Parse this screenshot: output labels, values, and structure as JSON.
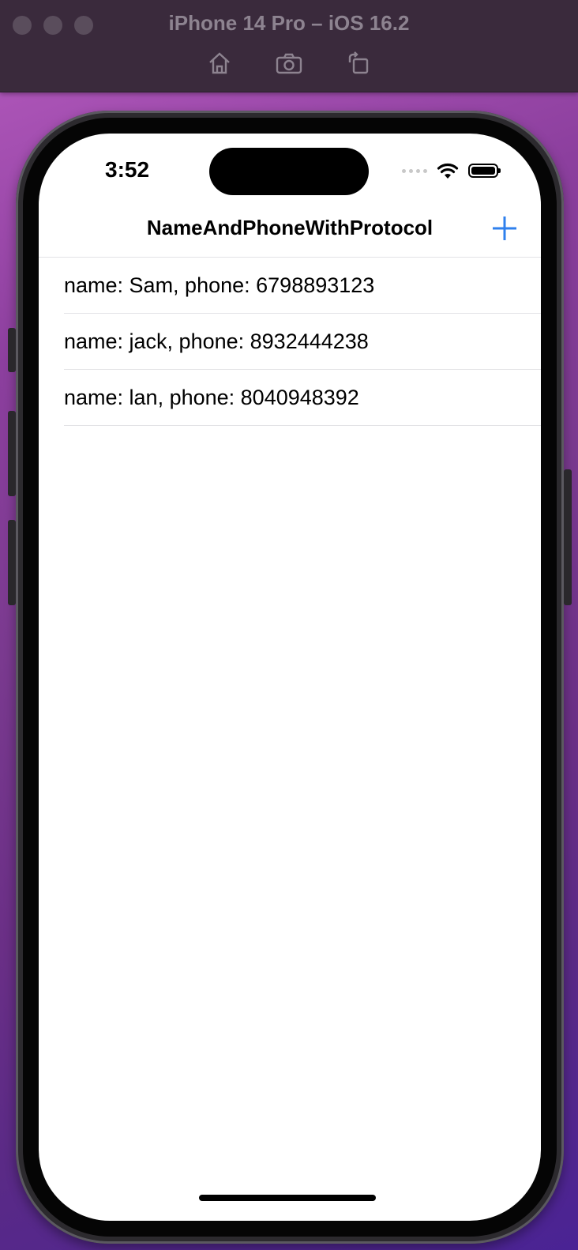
{
  "simulator": {
    "title": "iPhone 14 Pro – iOS 16.2",
    "tools": [
      "home-icon",
      "screenshot-icon",
      "rotate-icon"
    ]
  },
  "status_bar": {
    "time": "3:52"
  },
  "nav": {
    "title": "NameAndPhoneWithProtocol",
    "add_icon": "plus-icon"
  },
  "contacts": [
    {
      "label": "name: Sam, phone: 6798893123"
    },
    {
      "label": "name: jack, phone: 8932444238"
    },
    {
      "label": "name: lan, phone: 8040948392"
    }
  ],
  "colors": {
    "accent": "#2f80ed",
    "toolbar": "#3a2a3c"
  }
}
